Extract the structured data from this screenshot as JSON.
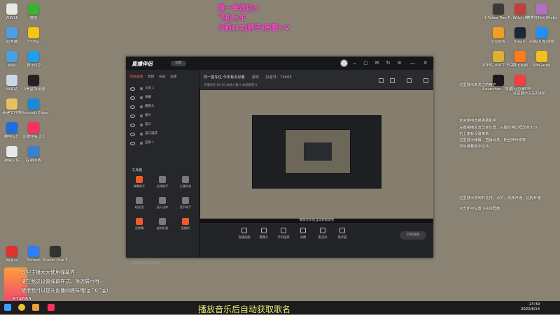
{
  "desktop_left": [
    {
      "label": "WIN10",
      "color": "#e8e8e8"
    },
    {
      "label": "微信",
      "color": "#3cb034"
    },
    {
      "label": "此电脑",
      "color": "#4aa0e0"
    },
    {
      "label": "YY语音",
      "color": "#f5c518"
    },
    {
      "label": "网络",
      "color": "#4aa0e0"
    },
    {
      "label": "腾讯QQ",
      "color": "#1ea0f0"
    },
    {
      "label": "回收站",
      "color": "#c8d8e8"
    },
    {
      "label": "小黑盒加速器",
      "color": "#222222"
    },
    {
      "label": "新建文件夹",
      "color": "#e8c060"
    },
    {
      "label": "Microsoft Edge",
      "color": "#1a8ad8"
    },
    {
      "label": "酷狗音乐",
      "color": "#1a6fe0"
    },
    {
      "label": "直播伴侣 2.1",
      "color": "#ff3060"
    },
    {
      "label": "新建文件",
      "color": "#e8e8e8"
    },
    {
      "label": "控制面板",
      "color": "#3a7fd0"
    }
  ],
  "desktop_bottom_left": [
    {
      "label": "网易云",
      "color": "#e03030"
    },
    {
      "label": "ToDesk",
      "color": "#2a7fff"
    },
    {
      "label": "Studio One 5",
      "color": "#333333"
    }
  ],
  "desktop_right": [
    {
      "label": "It Takes Two F...",
      "color": "#3a3a3a"
    },
    {
      "label": "Witch It",
      "color": "#c04040"
    },
    {
      "label": "鲁鲁师精灵(Mahjong...",
      "color": "#b070c0"
    },
    {
      "label": "QQ游戏",
      "color": "#f0a020"
    },
    {
      "label": "Steam",
      "color": "#1b2838"
    },
    {
      "label": "网易UU加速器",
      "color": "#1f8fff"
    },
    {
      "label": "PUBG BATTLEGR...",
      "color": "#e0b030"
    },
    {
      "label": "腾讯视频",
      "color": "#ff7a1a"
    },
    {
      "label": "WeGame",
      "color": "#f0c020"
    },
    {
      "label": "Launcher - 快捷方式",
      "color": "#1a1a1a"
    },
    {
      "label": "喜马拉雅FM",
      "color": "#f04040"
    }
  ],
  "overlay_text": {
    "line1": "网一单双钻3",
    "line2": "飞机上车",
    "line3": "火箭(12J牌子)房管+V"
  },
  "right_info": {
    "info1": "这里展示未关注的用户",
    "info2": "这是展示关注的用户",
    "info3": "欢迎使用直播弹幕助手",
    "info4": "左键拖拽消息改变位置、左键拉伸边框改变大小",
    "info5": "右上角有设置菜单",
    "info6": "这里展示弹幕、直播消息、粉丝牌升级等",
    "info7": "添加弹幕助手成功",
    "info8": "这里展示收到的礼物、点赞、贵族开通、钻粉开通",
    "info9": "点击即可设置小礼物屏蔽"
  },
  "app": {
    "title": "直播伴侣",
    "badge": "抖音",
    "room_title": "同一首车位 今天有点好看",
    "room_tag": "游戏",
    "room_meta": "抖音号：74665",
    "room_sub": "开播时长 00:00  本场人数 0  本场新增 0",
    "tabs": [
      "场景画面",
      "音频",
      "布局",
      "设置"
    ],
    "layers": [
      "文本 1",
      "弹幕",
      "摄像头",
      "图片",
      "窗口",
      "窗口捕获",
      "全屏 1"
    ],
    "tools_label": "工具箱",
    "tools": [
      "弹幕助手",
      "礼物助手",
      "主播任务",
      "粉丝团",
      "送人送你",
      "音乐助手",
      "送弹幕",
      "虚拟形象",
      "直播间"
    ],
    "left_footer": "点击直播间在线观众数",
    "caption": "播放音乐后自动获取歌名",
    "controls": [
      "直播画面",
      "摄像头",
      "手机投屏",
      "录像",
      "麦克风",
      "扬声器"
    ],
    "live_button": "开始直播"
  },
  "chat": {
    "line1": "欢迎主播大大使用弹幕秀~",
    "line2": "请在我这设置弹幕样式、筛选展示哦~",
    "line3": "使用我可以提升直播间趣味哦(≧^0^≦)",
    "count": "874665"
  },
  "taskbar": {
    "subtitle": "播放音乐后自动获取歌名",
    "time": "23:39",
    "date": "2022/6/14"
  }
}
